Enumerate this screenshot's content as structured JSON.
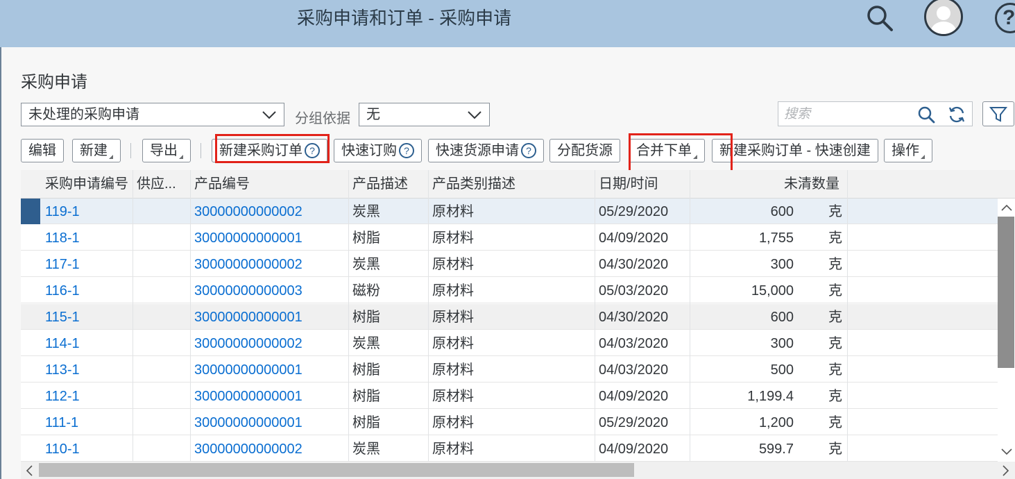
{
  "shell": {
    "title": "采购申请和订单 - 采购申请"
  },
  "page": {
    "title": "采购申请"
  },
  "filters": {
    "view_value": "未处理的采购申请",
    "grouping_label": "分组依据",
    "grouping_value": "无",
    "search_placeholder": "搜索"
  },
  "toolbar": {
    "edit": "编辑",
    "new": "新建",
    "export": "导出",
    "new_po": "新建采购订单",
    "quick_order": "快速订购",
    "quick_source_request": "快速货源申请",
    "assign_source": "分配货源",
    "merge_order": "合并下单",
    "new_po_quick": "新建采购订单 - 快速创建",
    "actions": "操作",
    "help_glyph": "?"
  },
  "table": {
    "columns": [
      "采购申请编号",
      "供应...",
      "产品编号",
      "产品描述",
      "产品类别描述",
      "日期/时间",
      "未清数量"
    ],
    "rows": [
      {
        "id": "119-1",
        "supplier": "",
        "product": "30000000000002",
        "desc": "炭黑",
        "category": "原材料",
        "date": "05/29/2020",
        "qty": "600",
        "unit": "克"
      },
      {
        "id": "118-1",
        "supplier": "",
        "product": "30000000000001",
        "desc": "树脂",
        "category": "原材料",
        "date": "04/09/2020",
        "qty": "1,755",
        "unit": "克"
      },
      {
        "id": "117-1",
        "supplier": "",
        "product": "30000000000002",
        "desc": "炭黑",
        "category": "原材料",
        "date": "04/30/2020",
        "qty": "300",
        "unit": "克"
      },
      {
        "id": "116-1",
        "supplier": "",
        "product": "30000000000003",
        "desc": "磁粉",
        "category": "原材料",
        "date": "05/03/2020",
        "qty": "15,000",
        "unit": "克"
      },
      {
        "id": "115-1",
        "supplier": "",
        "product": "30000000000001",
        "desc": "树脂",
        "category": "原材料",
        "date": "04/30/2020",
        "qty": "600",
        "unit": "克"
      },
      {
        "id": "114-1",
        "supplier": "",
        "product": "30000000000002",
        "desc": "炭黑",
        "category": "原材料",
        "date": "04/03/2020",
        "qty": "300",
        "unit": "克"
      },
      {
        "id": "113-1",
        "supplier": "",
        "product": "30000000000001",
        "desc": "树脂",
        "category": "原材料",
        "date": "04/03/2020",
        "qty": "500",
        "unit": "克"
      },
      {
        "id": "112-1",
        "supplier": "",
        "product": "30000000000001",
        "desc": "树脂",
        "category": "原材料",
        "date": "04/09/2020",
        "qty": "1,199.4",
        "unit": "克"
      },
      {
        "id": "111-1",
        "supplier": "",
        "product": "30000000000001",
        "desc": "树脂",
        "category": "原材料",
        "date": "05/29/2020",
        "qty": "1,200",
        "unit": "克"
      },
      {
        "id": "110-1",
        "supplier": "",
        "product": "30000000000002",
        "desc": "炭黑",
        "category": "原材料",
        "date": "04/09/2020",
        "qty": "599.7",
        "unit": "克"
      }
    ]
  },
  "colors": {
    "shell_bg": "#a9c5df",
    "link": "#0a6ed1",
    "highlight_box": "#e2231a",
    "selected_marker": "#2f5e8e"
  }
}
